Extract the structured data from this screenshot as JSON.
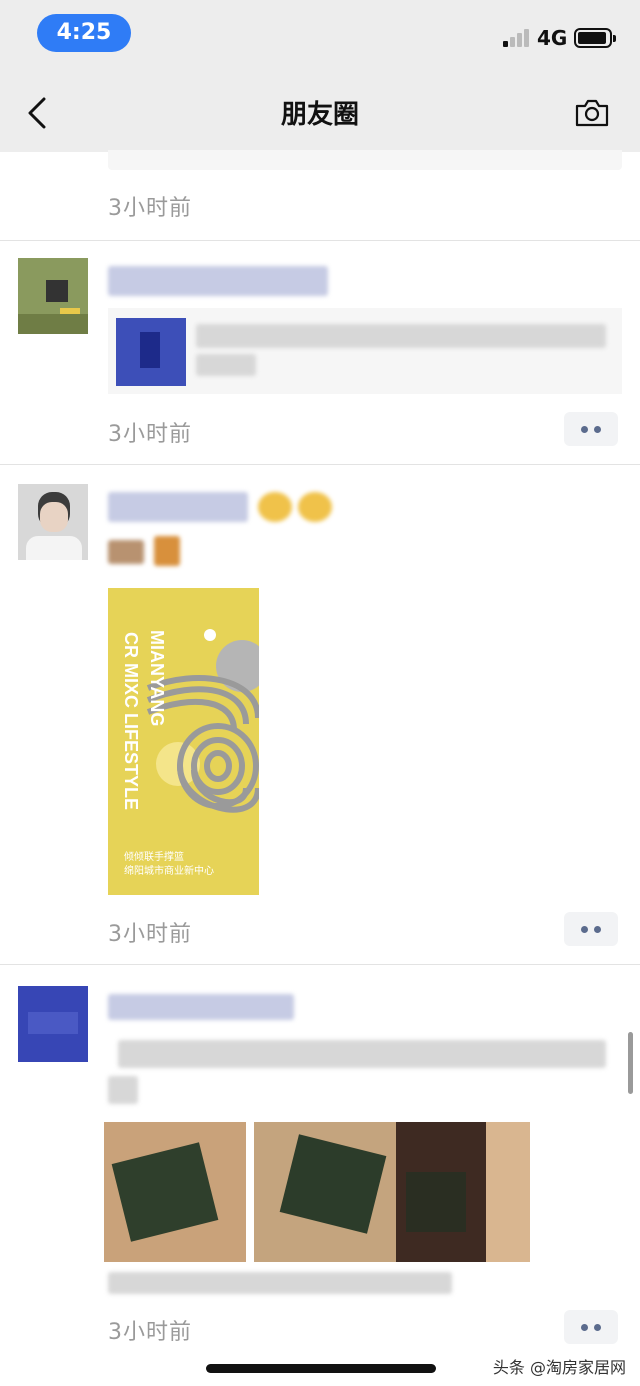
{
  "status_bar": {
    "time": "4:25",
    "network": "4G"
  },
  "nav": {
    "title": "朋友圈",
    "back_icon": "chevron-left-icon",
    "camera_icon": "camera-icon"
  },
  "feed": {
    "posts": [
      {
        "time": "3小时前"
      },
      {
        "time": "3小时前"
      },
      {
        "time": "3小时前",
        "poster": {
          "line1": "MIANYANG",
          "line2": "CR MIXC LIFESTYLE",
          "caption1": "倾倾联手撑篮",
          "caption2": "绵阳城市商业新中心"
        }
      },
      {
        "time": "3小时前"
      }
    ]
  },
  "watermark": "头条 @淘房家居网",
  "colors": {
    "accent_blue": "#2f7cf6",
    "nav_bg": "#ededed",
    "poster_yellow": "#e6d357",
    "link_color": "#5b6b8d"
  }
}
